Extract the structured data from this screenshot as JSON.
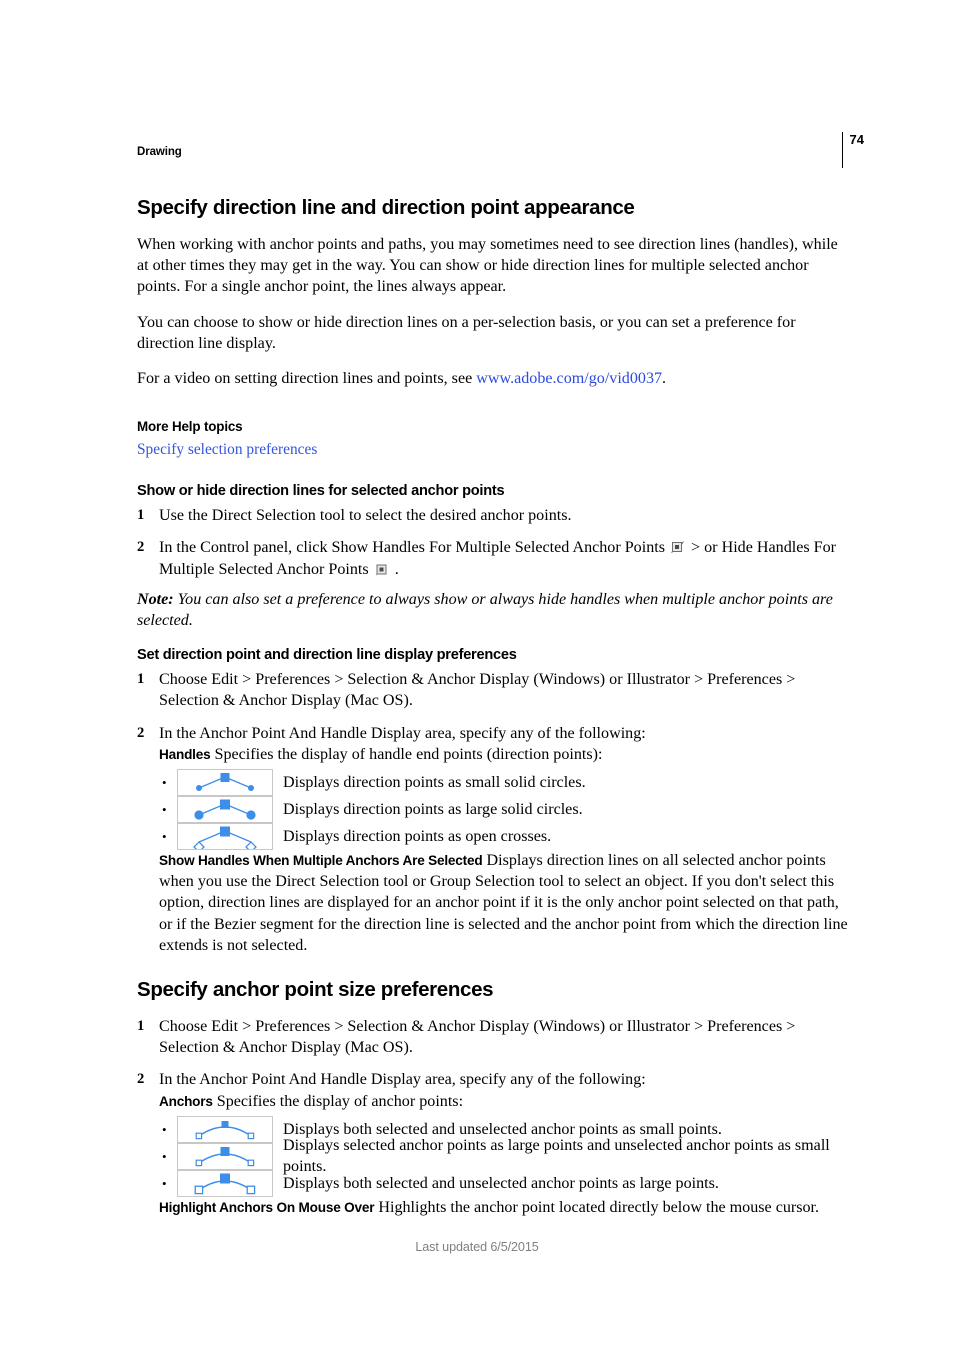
{
  "header": {
    "section_title": "Drawing",
    "page_number": "74"
  },
  "main": {
    "title": "Specify direction line and direction point appearance",
    "intro_paragraph_1": "When working with anchor points and paths, you may sometimes need to see direction lines (handles), while at other times they may get in the way. You can show or hide direction lines for multiple selected anchor points. For a single anchor point, the lines always appear.",
    "intro_paragraph_2": "You can choose to show or hide direction lines on a per-selection basis, or you can set a preference for direction line display.",
    "video_line_prefix": "For a video on setting direction lines and points, see ",
    "video_link_text": "www.adobe.com/go/vid0037",
    "video_line_suffix": ".",
    "more_help_heading": "More Help topics",
    "more_help_link": "Specify selection preferences",
    "section_show_hide": {
      "heading": "Show or hide direction lines for selected anchor points",
      "steps": [
        {
          "number": "1",
          "text": "Use the Direct Selection tool to select the desired anchor points."
        },
        {
          "number": "2",
          "text_part_1": "In the Control panel, click Show Handles For Multiple Selected Anchor Points ",
          "icon_1": "show-handles-button-icon",
          "text_part_2": " > or Hide Handles For Multiple Selected Anchor Points ",
          "icon_2": "hide-handles-button-icon",
          "text_part_3": " ."
        }
      ],
      "note_label": "Note:",
      "note_text": " You can also set a preference to always show or always hide handles when multiple anchor points are selected."
    },
    "section_set_direction": {
      "heading": "Set direction point and direction line display preferences",
      "steps": [
        {
          "number": "1",
          "text": "Choose Edit > Preferences > Selection & Anchor Display (Windows) or Illustrator > Preferences > Selection & Anchor Display (Mac OS)."
        },
        {
          "number": "2",
          "text": "In the Anchor Point And Handle Display area, specify any of the following:"
        }
      ],
      "handles_term": "Handles",
      "handles_description": " Specifies the display of handle end points (direction points):",
      "handle_options": [
        {
          "icon": "handles-small-solid-circles-icon",
          "caption": "Displays direction points as small solid circles."
        },
        {
          "icon": "handles-large-solid-circles-icon",
          "caption": "Displays direction points as large solid circles."
        },
        {
          "icon": "handles-open-crosses-icon",
          "caption": "Displays direction points as open crosses."
        }
      ],
      "show_handles_term": "Show Handles When Multiple Anchors Are Selected",
      "show_handles_description": " Displays direction lines on all selected anchor points when you use the Direct Selection tool or Group Selection tool to select an object. If you don't select this option, direction lines are displayed for an anchor point if it is the only anchor point selected on that path, or if the Bezier segment for the direction line is selected and the anchor point from which the direction line extends is not selected."
    },
    "section_anchor_size": {
      "heading": "Specify anchor point size preferences",
      "steps": [
        {
          "number": "1",
          "text": "Choose Edit > Preferences > Selection & Anchor Display (Windows) or Illustrator > Preferences > Selection & Anchor Display (Mac OS)."
        },
        {
          "number": "2",
          "text": "In the Anchor Point And Handle Display area, specify any of the following:"
        }
      ],
      "anchors_term": "Anchors",
      "anchors_description": " Specifies the display of anchor points:",
      "anchor_options": [
        {
          "icon": "anchors-both-small-icon",
          "caption": "Displays both selected and unselected anchor points as small points."
        },
        {
          "icon": "anchors-selected-large-icon",
          "caption": "Displays selected anchor points as large points and unselected anchor points as small points."
        },
        {
          "icon": "anchors-both-large-icon",
          "caption": "Displays both selected and unselected anchor points as large points."
        }
      ],
      "highlight_term": "Highlight Anchors On Mouse Over",
      "highlight_description": " Highlights the anchor point located directly below the mouse cursor."
    }
  },
  "footer": {
    "last_updated": "Last updated 6/5/2015"
  },
  "colors": {
    "link": "#2b4ae0",
    "illustration_blue": "#3d8ee8",
    "footer_gray": "#808080",
    "figure_border": "#c7c7c7"
  }
}
